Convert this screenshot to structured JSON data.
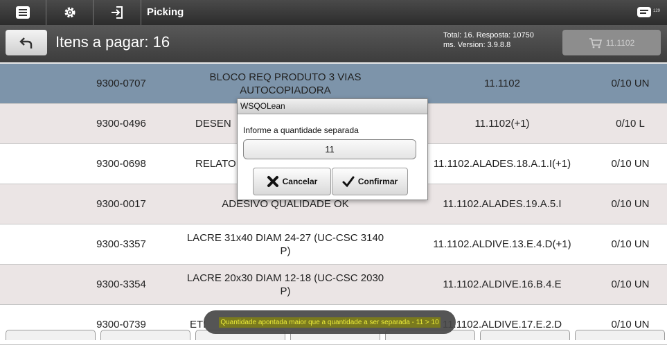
{
  "topbar": {
    "title": "Picking",
    "badge_count": "129",
    "icons": [
      "menu-icon",
      "settings-gear-icon",
      "login-icon",
      "message-icon"
    ]
  },
  "header": {
    "title": "Itens a pagar: 16",
    "info_line1": "Total: 16. Resposta: 10750",
    "info_line2": "ms. Version: 3.9.8.8",
    "route_label": "11.1102"
  },
  "rows": [
    {
      "code": "9300-0707",
      "desc": "BLOCO REQ PRODUTO 3 VIAS AUTOCOPIADORA",
      "loc": "11.1102",
      "qty": "0/10 UN"
    },
    {
      "code": "9300-0496",
      "desc": "DESEN",
      "loc": "11.1102(+1)",
      "qty": "0/10 L"
    },
    {
      "code": "9300-0698",
      "desc": "RELATOI",
      "loc": "11.1102.ALADES.18.A.1.I(+1)",
      "qty": "0/10 UN"
    },
    {
      "code": "9300-0017",
      "desc": "ADESIVO QUALIDADE OK",
      "loc": "11.1102.ALADES.19.A.5.I",
      "qty": "0/10 UN"
    },
    {
      "code": "9300-3357",
      "desc": "LACRE 31x40 DIAM 24-27 (UC-CSC 3140 P)",
      "loc": "11.1102.ALDIVE.13.E.4.D(+1)",
      "qty": "0/10 UN"
    },
    {
      "code": "9300-3354",
      "desc": "LACRE 20x30 DIAM 12-18 (UC-CSC 2030 P)",
      "loc": "11.1102.ALDIVE.16.B.4.E",
      "qty": "0/10 UN"
    },
    {
      "code": "9300-0739",
      "desc": "ETI",
      "loc": "11.1102.ALDIVE.17.E.2.D",
      "qty": "0/10 UN"
    }
  ],
  "dialog": {
    "title": "WSQOLean",
    "label": "Informe a quantidade separada",
    "value": "11",
    "cancel_label": "Cancelar",
    "confirm_label": "Confirmar"
  },
  "toast": {
    "message": "Quantidade apontada maior que a quantidade a ser separada - 11 > 10"
  },
  "colors": {
    "selected_row": "#7d94aa",
    "alt_row": "#ebe5e5",
    "toast_text": "#ecec3a"
  }
}
